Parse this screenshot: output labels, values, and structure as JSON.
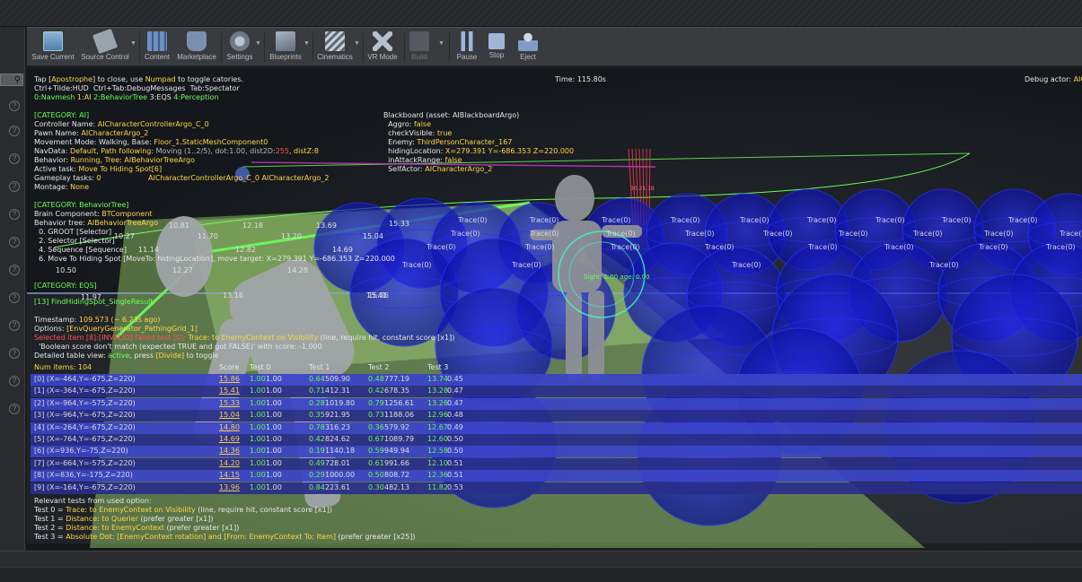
{
  "toolbar": {
    "items": [
      {
        "label": "Save Current",
        "icon": "save-icon",
        "disabled": false
      },
      {
        "label": "Source Control",
        "icon": "source-control-icon",
        "disabled": false
      },
      {
        "label": "Content",
        "icon": "content-icon",
        "disabled": false
      },
      {
        "label": "Marketplace",
        "icon": "marketplace-icon",
        "disabled": false
      },
      {
        "label": "Settings",
        "icon": "settings-icon",
        "disabled": false
      },
      {
        "label": "Blueprints",
        "icon": "blueprints-icon",
        "disabled": false
      },
      {
        "label": "Cinematics",
        "icon": "cinematics-icon",
        "disabled": false
      },
      {
        "label": "VR Mode",
        "icon": "vr-mode-icon",
        "disabled": false
      },
      {
        "label": "Build",
        "icon": "build-icon",
        "disabled": true
      },
      {
        "label": "Pause",
        "icon": "pause-icon",
        "disabled": false
      },
      {
        "label": "Stop",
        "icon": "stop-icon",
        "disabled": false
      },
      {
        "label": "Eject",
        "icon": "eject-icon",
        "disabled": false
      }
    ]
  },
  "hud": {
    "tap_pre": "Tap [",
    "tap_key": "Apostrophe",
    "tap_mid": "] to close, use ",
    "tap_numpad": "Numpad",
    "tap_post": " to toggle catories.",
    "line2": "Ctrl+Tilde:HUD  Ctrl+Tab:DebugMessages  Tab:Spectator",
    "cat0": "0:Navmesh",
    "cat1": "1:AI",
    "cat2": "2:BehaviorTree",
    "cat3": "3:EQS",
    "cat4": "4:Perception",
    "time": "Time: 115.80s",
    "debug_actor_label": "Debug actor:",
    "debug_actor_value": "AIC",
    "ai_category": "[CATEGORY: AI]",
    "controller_name_label": "Controller Name:",
    "controller_name_value": "AICharacterControllerArgo_C_0",
    "pawn_name_label": "Pawn Name:",
    "pawn_name_value": "AICharacterArgo_2",
    "movement_mode_label": "Movement Mode:",
    "movement_mode_value": "Walking, Base: ",
    "movement_mode_base": "Floor_1.StaticMeshComponent0",
    "navdata_label": "NavData:",
    "navdata_value": "Default, Path following: ",
    "navdata_moving": "Moving (1..2/5), dot:1.00, dist2D:",
    "navdata_dist": "255",
    "navdata_distz": ", distZ:8",
    "behavior_label": "Behavior:",
    "behavior_value": "Running, Tree: AIBehaviorTreeArgo",
    "active_task_label": "Active task:",
    "active_task_value": "Move To Hiding Spot[6]",
    "gameplay_tasks_label": "Gameplay tasks:",
    "gameplay_tasks_value": "0",
    "montage_label": "Montage:",
    "montage_value": "None",
    "overhead_label": "AICharacterControllerArgo_C_0 AICharacterArgo_2",
    "blackboard_title": "Blackboard (asset: AIBlackboardArgo)",
    "bb_aggro_key": "Aggro:",
    "bb_aggro_val": "false",
    "bb_check_key": "checkVisible:",
    "bb_check_val": "true",
    "bb_enemy_key": "Enemy:",
    "bb_enemy_val": "ThirdPersonCharacter_167",
    "bb_hiding_key": "hidingLocation:",
    "bb_hiding_val": "X=279.391 Y=-686.353 Z=220.000",
    "bb_attack_key": "inAttackRange:",
    "bb_attack_val": "false",
    "bb_self_key": "SelfActor:",
    "bb_self_val": "AICharacterArgo_2",
    "bt_category": "[CATEGORY: BehaviorTree]",
    "brain_label": "Brain Component:",
    "brain_value": "BTComponent",
    "bt_tree_label": "Behavior tree:",
    "bt_tree_value": "AIBehaviorTreeArgo",
    "bt_line0": "0. GROOT [Selector]",
    "bt_line1": "2. Selector [Selector]",
    "bt_line2": "4. Sequence [Sequence]",
    "bt_line3": "6. Move To Hiding Spot [MoveTo: hidingLocation], move target: X=279.391 Y=-686.353 Z=220.000",
    "eqs_category": "[CATEGORY: EQS]",
    "eqs_query": "[13] FindHidingSpot_SingleResult",
    "timestamp_label": "Timestamp:",
    "timestamp_value": "109.573 (~ 6.23s ago)",
    "options_label": "Options:",
    "options_value": "[EnvQueryGenerator_PathingGrid_1]",
    "selected_item": "Selected item [8]:[INVALID] failed test [0]:",
    "selected_trace": " Trace: to EnemyContext on Visibility",
    "selected_params": " (line, require hit, constant score [x1])",
    "bool_score": "'Boolean score don't match (expected TRUE and got FALSE)' with score: -1.000",
    "detailed_pre": "Detailed table view: ",
    "detailed_active": "active",
    "detailed_mid": ", press ",
    "detailed_key": "[Divide]",
    "detailed_post": " to toggle",
    "relevant_title": "Relevant tests from used option:",
    "test0_label": "Test 0 = ",
    "test0_value": "Trace: to EnemyContext on Visibility",
    "test0_params": " (line, require hit, constant score [x1])",
    "test1_label": "Test 1 = ",
    "test1_value": "Distance: to Querier",
    "test1_params": " (prefer greater [x1])",
    "test2_label": "Test 2 = ",
    "test2_value": "Distance: to EnemyContext",
    "test2_params": " (prefer greater [x1])",
    "test3_label": "Test 3 = ",
    "test3_value": "Absolute Dot: [EnemyContext rotation] and [From: EnemyContext To: Item]",
    "test3_params": " (prefer greater [x25])"
  },
  "eqs_table": {
    "headers": [
      "Num items: 104",
      "Score",
      "Test 0",
      "Test 1",
      "Test 2",
      "Test 3"
    ],
    "rows": [
      {
        "item": "[0] (X=-464,Y=-675,Z=220)",
        "score": "15.86",
        "t0": "1.00",
        "t0b": "1.00",
        "t1": "0.64",
        "t1b": "509.90",
        "t2": "0.48",
        "t2b": "777.19",
        "t3": "13.74",
        "t3b": "0.45"
      },
      {
        "item": "[1] (X=-364,Y=-675,Z=220)",
        "score": "15.41",
        "t0": "1.00",
        "t0b": "1.00",
        "t1": "0.71",
        "t1b": "412.31",
        "t2": "0.42",
        "t2b": "678.35",
        "t3": "13.28",
        "t3b": "0.47"
      },
      {
        "item": "[2] (X=-964,Y=-575,Z=220)",
        "score": "15.33",
        "t0": "1.00",
        "t0b": "1.00",
        "t1": "0.28",
        "t1b": "1019.80",
        "t2": "0.79",
        "t2b": "1256.61",
        "t3": "13.26",
        "t3b": "0.47"
      },
      {
        "item": "[3] (X=-964,Y=-675,Z=220)",
        "score": "15.04",
        "t0": "1.00",
        "t0b": "1.00",
        "t1": "0.35",
        "t1b": "921.95",
        "t2": "0.73",
        "t2b": "1188.06",
        "t3": "12.96",
        "t3b": "0.48"
      },
      {
        "item": "[4] (X=-264,Y=-675,Z=220)",
        "score": "14.80",
        "t0": "1.00",
        "t0b": "1.00",
        "t1": "0.78",
        "t1b": "316.23",
        "t2": "0.36",
        "t2b": "579.92",
        "t3": "12.67",
        "t3b": "0.49"
      },
      {
        "item": "[5] (X=-764,Y=-675,Z=220)",
        "score": "14.69",
        "t0": "1.00",
        "t0b": "1.00",
        "t1": "0.42",
        "t1b": "824.62",
        "t2": "0.67",
        "t2b": "1089.79",
        "t3": "12.60",
        "t3b": "0.50"
      },
      {
        "item": "[6] (X=936,Y=-75,Z=220)",
        "score": "14.36",
        "t0": "1.00",
        "t0b": "1.00",
        "t1": "0.19",
        "t1b": "1140.18",
        "t2": "0.59",
        "t2b": "949.94",
        "t3": "12.58",
        "t3b": "0.50"
      },
      {
        "item": "[7] (X=-664,Y=-575,Z=220)",
        "score": "14.20",
        "t0": "1.00",
        "t0b": "1.00",
        "t1": "0.49",
        "t1b": "728.01",
        "t2": "0.61",
        "t2b": "991.66",
        "t3": "12.10",
        "t3b": "0.51"
      },
      {
        "item": "[8] (X=836,Y=-175,Z=220)",
        "score": "14.15",
        "t0": "1.00",
        "t0b": "1.00",
        "t1": "0.29",
        "t1b": "1000.00",
        "t2": "0.50",
        "t2b": "808.72",
        "t3": "12.36",
        "t3b": "0.51"
      },
      {
        "item": "[9] (X=-164,Y=-675,Z=220)",
        "score": "13.96",
        "t0": "1.00",
        "t0b": "1.00",
        "t1": "0.84",
        "t1b": "223.61",
        "t2": "0.30",
        "t2b": "482.13",
        "t3": "11.82",
        "t3b": "0.53"
      }
    ]
  },
  "world_labels": {
    "traces": [
      "Trace(0)",
      "Trace(0)",
      "Trace(0)",
      "Trace(0)",
      "Trace(0)",
      "Trace(0)",
      "Trace(0)",
      "Trace(0)",
      "Trace(0)",
      "Trace(0)",
      "Trace(0)",
      "Trace(0)",
      "Trace(0)",
      "Trace(0)",
      "Trace(0)",
      "Trace(0)",
      "Trace(0)",
      "Trace(0)",
      "Trace(0)",
      "Trace(0)",
      "Trace(0)",
      "Trace(0)",
      "Trace(0)",
      "Trace(0)",
      "Trace(0)",
      "Trace(0)",
      "Trace(0)",
      "Trace(0)",
      "Trace(0)",
      "Trace(0)"
    ],
    "scores": [
      "10.81",
      "12.18",
      "13.69",
      "15.33",
      "10.27",
      "11.70",
      "13.20",
      "15.04",
      "11.14",
      "12.82",
      "14.69",
      "10.50",
      "12.27",
      "14.28",
      "11.97",
      "13.16",
      "15.86",
      "15.41"
    ],
    "sight": "Sight: 1.00 age: 0.00",
    "distance_tag": "30.21.18"
  },
  "colors": {
    "accent_yellow": "#ffd54a",
    "accent_green": "#6bff5a",
    "error_red": "#ff5050",
    "sphere_blue": "#1a1fd6"
  }
}
